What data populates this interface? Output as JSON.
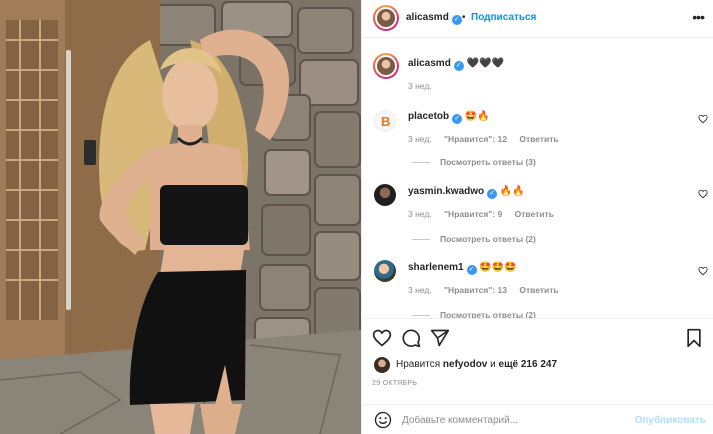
{
  "post": {
    "author": "alicasmd",
    "separator": "•",
    "follow_label": "Подписаться",
    "more_label": "•••"
  },
  "caption": {
    "username": "alicasmd",
    "text": "🖤🖤🖤",
    "time": "3 нед."
  },
  "comments": [
    {
      "username": "placetob",
      "text": "🤩🔥",
      "time": "3 нед.",
      "likes": "\"Нравится\": 12",
      "reply_label": "Ответить",
      "view_replies": "Посмотреть ответы (3)",
      "avatar_letter": "B"
    },
    {
      "username": "yasmin.kwadwo",
      "text": "🔥🔥",
      "time": "3 нед.",
      "likes": "\"Нравится\": 9",
      "reply_label": "Ответить",
      "view_replies": "Посмотреть ответы (2)"
    },
    {
      "username": "sharlenem1",
      "text": "🤩🤩🤩",
      "time": "3 нед.",
      "likes": "\"Нравится\": 13",
      "reply_label": "Ответить",
      "view_replies": "Посмотреть ответы (2)"
    }
  ],
  "likes": {
    "prefix": "Нравится",
    "user": "nefyodov",
    "middle": "и",
    "count": "ещё 216 247"
  },
  "date": "29 ОКТЯБРЬ",
  "add_comment": {
    "placeholder": "Добавьте комментарий...",
    "publish_label": "Опубликовать"
  },
  "icons": [
    "heart-icon",
    "comment-icon",
    "share-icon",
    "bookmark-icon",
    "smile-icon",
    "verified-icon",
    "more-icon"
  ],
  "colors": {
    "link": "#0095f6",
    "verified": "#3897f0",
    "muted": "#8e8e8e",
    "publish_disabled": "#b2dffc"
  }
}
